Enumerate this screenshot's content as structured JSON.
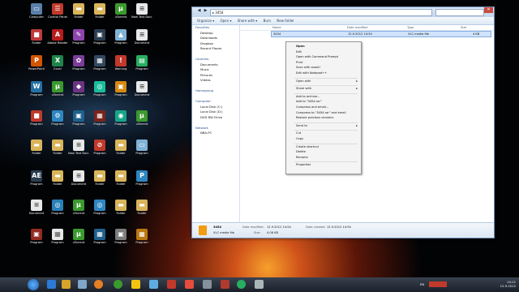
{
  "desktop": {
    "icons": [
      {
        "label": "Computer",
        "color": "#5a7fa8",
        "glyph": "▭"
      },
      {
        "label": "Control Panel",
        "color": "#c0392b",
        "glyph": "☰"
      },
      {
        "label": "Folder",
        "color": "#d9b45a",
        "glyph": "▬"
      },
      {
        "label": "Folder",
        "color": "#d9b45a",
        "glyph": "▬"
      },
      {
        "label": "uTorrent",
        "color": "#3a9a2e",
        "glyph": "μ"
      },
      {
        "label": "New Text Document",
        "color": "#e8e8e8",
        "glyph": "≡"
      },
      {
        "label": "Folder",
        "color": "#c03a3a",
        "glyph": "■"
      },
      {
        "label": "Adobe Reader",
        "color": "#b71c1c",
        "glyph": "A"
      },
      {
        "label": "Program",
        "color": "#8e44ad",
        "glyph": "✎"
      },
      {
        "label": "Program",
        "color": "#2c3e50",
        "glyph": "▣"
      },
      {
        "label": "Program",
        "color": "#7fb3d5",
        "glyph": "▲"
      },
      {
        "label": "Document",
        "color": "#e8e8e8",
        "glyph": "≡"
      },
      {
        "label": "PowerPoint",
        "color": "#d35400",
        "glyph": "P"
      },
      {
        "label": "Excel",
        "color": "#1e8449",
        "glyph": "X"
      },
      {
        "label": "Program",
        "color": "#7d3c98",
        "glyph": "✿"
      },
      {
        "label": "Program",
        "color": "#34495e",
        "glyph": "▦"
      },
      {
        "label": "Warning",
        "color": "#c0392b",
        "glyph": "!"
      },
      {
        "label": "Program",
        "color": "#27ae60",
        "glyph": "▤"
      },
      {
        "label": "Program",
        "color": "#2471a3",
        "glyph": "W"
      },
      {
        "label": "uTorrent",
        "color": "#3a9a2e",
        "glyph": "μ"
      },
      {
        "label": "Program",
        "color": "#6c3483",
        "glyph": "◆"
      },
      {
        "label": "Program",
        "color": "#1abc9c",
        "glyph": "◎"
      },
      {
        "label": "Program",
        "color": "#d68910",
        "glyph": "▣"
      },
      {
        "label": "Document",
        "color": "#e8e8e8",
        "glyph": "≡"
      },
      {
        "label": "Program",
        "color": "#c0392b",
        "glyph": "■"
      },
      {
        "label": "Program",
        "color": "#2e86c1",
        "glyph": "⚙"
      },
      {
        "label": "Program",
        "color": "#1f618d",
        "glyph": "▣"
      },
      {
        "label": "Program",
        "color": "#7b241c",
        "glyph": "▦"
      },
      {
        "label": "Program",
        "color": "#17a589",
        "glyph": "◉"
      },
      {
        "label": "uTorrent",
        "color": "#3a9a2e",
        "glyph": "μ"
      },
      {
        "label": "Folder",
        "color": "#d9b45a",
        "glyph": "▬"
      },
      {
        "label": "Folder",
        "color": "#d9b45a",
        "glyph": "▬"
      },
      {
        "label": "New Text Document",
        "color": "#e8e8e8",
        "glyph": "≡"
      },
      {
        "label": "Program",
        "color": "#c0392b",
        "glyph": "⊘"
      },
      {
        "label": "Folder",
        "color": "#d9b45a",
        "glyph": "▬"
      },
      {
        "label": "Program",
        "color": "#7fb3d5",
        "glyph": "▭"
      },
      {
        "label": "Program",
        "color": "#2c3e50",
        "glyph": "AE"
      },
      {
        "label": "Folder",
        "color": "#d9b45a",
        "glyph": "▬"
      },
      {
        "label": "Document",
        "color": "#e8e8e8",
        "glyph": "≡"
      },
      {
        "label": "Folder",
        "color": "#d9b45a",
        "glyph": "▬"
      },
      {
        "label": "Folder",
        "color": "#d9b45a",
        "glyph": "▬"
      },
      {
        "label": "Program",
        "color": "#2e86c1",
        "glyph": "P"
      },
      {
        "label": "Document",
        "color": "#e8e8e8",
        "glyph": "≡"
      },
      {
        "label": "Program",
        "color": "#2980b9",
        "glyph": "◎"
      },
      {
        "label": "uTorrent",
        "color": "#3a9a2e",
        "glyph": "μ"
      },
      {
        "label": "Program",
        "color": "#2e86c1",
        "glyph": "◎"
      },
      {
        "label": "Folder",
        "color": "#d9b45a",
        "glyph": "▬"
      },
      {
        "label": "Folder",
        "color": "#d9b45a",
        "glyph": "▬"
      },
      {
        "label": "Program",
        "color": "#922b21",
        "glyph": "▣"
      },
      {
        "label": "Program",
        "color": "#e8e8e8",
        "glyph": "▦"
      },
      {
        "label": "uTorrent",
        "color": "#3a9a2e",
        "glyph": "μ"
      },
      {
        "label": "Program",
        "color": "#1f618d",
        "glyph": "▦"
      },
      {
        "label": "Program",
        "color": "#7b7d7d",
        "glyph": "▣"
      },
      {
        "label": "Program",
        "color": "#b9770e",
        "glyph": "▦"
      }
    ]
  },
  "explorer": {
    "address": "▸ 3454",
    "toolbar": [
      "Organize ▾",
      "Open ▾",
      "Share with ▾",
      "Burn",
      "New folder"
    ],
    "nav": [
      "Favorites",
      "Desktop",
      "Downloads",
      "Dropbox",
      "Recent Places",
      "",
      "Libraries",
      "Documents",
      "Music",
      "Pictures",
      "Videos",
      "",
      "Homegroup",
      "",
      "Computer",
      "Local Disk (C:)",
      "Local Disk (D:)",
      "DVD RW Drive",
      "",
      "Network",
      "NBA-PC"
    ],
    "columns": [
      "Name",
      "Date modified",
      "Type",
      "Size"
    ],
    "file": {
      "name": "3454",
      "date": "12.9.2012 14:54",
      "type": "VLC media file",
      "size": "4 KB"
    },
    "details": {
      "name": "3454",
      "type": "VLC media file",
      "modified_label": "Date modified:",
      "modified": "12.9.2012 14:54",
      "created_label": "Date created:",
      "created": "12.9.2012 14:54",
      "size_label": "Size:",
      "size": "4.08 KB"
    }
  },
  "context_menu": {
    "items": [
      {
        "label": "Open",
        "bold": true,
        "group": 1
      },
      {
        "label": "Edit",
        "group": 1
      },
      {
        "label": "Open with Command Prompt",
        "group": 1
      },
      {
        "label": "Print",
        "group": 1
      },
      {
        "label": "Scan with avast!",
        "group": 1
      },
      {
        "label": "Edit with Notepad++",
        "group": 1
      },
      {
        "label": "Open with",
        "arrow": true,
        "group": 2
      },
      {
        "label": "Share with",
        "arrow": true,
        "group": 3
      },
      {
        "label": "Add to archive...",
        "group": 4
      },
      {
        "label": "Add to \"3454.rar\"",
        "group": 4
      },
      {
        "label": "Compress and email...",
        "group": 4
      },
      {
        "label": "Compress to \"3454.rar\" and email",
        "group": 4
      },
      {
        "label": "Restore previous versions",
        "group": 4
      },
      {
        "label": "Send to",
        "arrow": true,
        "group": 5
      },
      {
        "label": "Cut",
        "group": 6
      },
      {
        "label": "Copy",
        "group": 6
      },
      {
        "label": "Create shortcut",
        "group": 7
      },
      {
        "label": "Delete",
        "group": 7
      },
      {
        "label": "Rename",
        "group": 7
      },
      {
        "label": "Properties",
        "group": 8
      }
    ]
  },
  "taskbar": {
    "time": "14:11",
    "date": "12.9.2012",
    "lang": "EN"
  }
}
